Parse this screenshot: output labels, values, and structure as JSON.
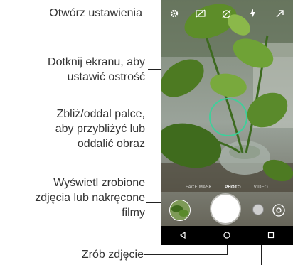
{
  "callouts": {
    "settings": "Otwórz ustawienia",
    "focus_l1": "Dotknij ekranu, aby",
    "focus_l2": "ustawić ostrość",
    "zoom_l1": "Zbliż/oddal palce,",
    "zoom_l2": "aby przybliżyć lub",
    "zoom_l3": "oddalić obraz",
    "gallery_l1": "Wyświetl zrobione",
    "gallery_l2": "zdjęcia lub nakręcone",
    "gallery_l3": "filmy",
    "shoot": "Zrób zdjęcie"
  },
  "camera": {
    "modes": [
      "FACE MASK",
      "PHOTO",
      "VIDEO"
    ],
    "active_mode": "PHOTO",
    "top_icons": [
      "gear-icon",
      "hdr-off-icon",
      "timer-off-icon",
      "flash-auto-icon",
      "scene-icon"
    ]
  }
}
